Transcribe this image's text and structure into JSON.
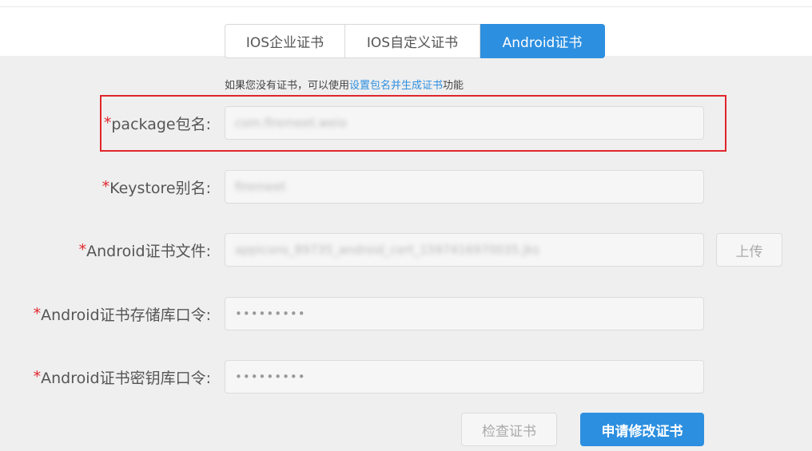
{
  "tabs": [
    {
      "label": "IOS企业证书",
      "active": false
    },
    {
      "label": "IOS自定义证书",
      "active": false
    },
    {
      "label": "Android证书",
      "active": true
    }
  ],
  "hint": {
    "prefix": "如果您没有证书，可以使用",
    "link": "设置包名并生成证书",
    "suffix": "功能"
  },
  "form": {
    "required_mark": "*",
    "package": {
      "label": "package包名:",
      "value": "com.firemeet.weio"
    },
    "keystore": {
      "label": "Keystore别名:",
      "value": "firemeet"
    },
    "cert_file": {
      "label": "Android证书文件:",
      "value": "appicons_89735_android_cert_1597416970035.jks",
      "upload_label": "上传"
    },
    "store_password": {
      "label": "Android证书存储库口令:",
      "value": "•••••••••"
    },
    "key_password": {
      "label": "Android证书密钥库口令:",
      "value": "•••••••••"
    }
  },
  "actions": {
    "check_label": "检查证书",
    "apply_label": "申请修改证书"
  },
  "colors": {
    "accent": "#2d8fe0",
    "required": "#e0262c",
    "highlight_border": "#e0262c"
  }
}
